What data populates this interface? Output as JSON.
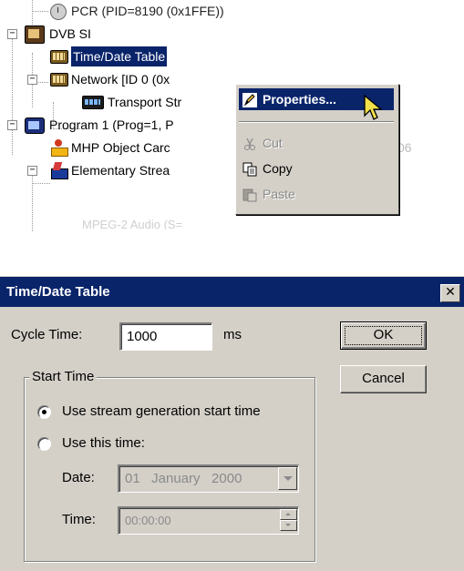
{
  "tree": {
    "items": [
      {
        "label": "PCR (PID=8190 (0x1FFE))",
        "icon": "clock-icon"
      },
      {
        "label": "DVB SI",
        "icon": "dvb-si-icon",
        "expander": "−"
      },
      {
        "label": "Time/Date Table",
        "icon": "table-icon",
        "selected": true
      },
      {
        "label": "Network [ID 0 (0x",
        "icon": "table-icon",
        "expander": "−"
      },
      {
        "label": "Transport Str",
        "icon": "film-icon"
      },
      {
        "label": "Program 1 (Prog=1, P",
        "icon": "program-icon",
        "expander": "−"
      },
      {
        "label": "MHP Object Carc",
        "icon": "mhp-icon"
      },
      {
        "label": "Elementary Strea",
        "icon": "elementary-stream-icon",
        "expander": "−"
      },
      {
        "label": "MPEG-2 Audio (S=",
        "icon": "audio-icon",
        "faded": true
      }
    ],
    "partial_right_text": "06"
  },
  "context_menu": {
    "items": [
      {
        "label": "Properties...",
        "icon": "pencil-icon",
        "state": "active"
      },
      {
        "label": "Cut",
        "icon": "scissors-icon",
        "state": "disabled"
      },
      {
        "label": "Copy",
        "icon": "copy-icon",
        "state": "enabled"
      },
      {
        "label": "Paste",
        "icon": "paste-icon",
        "state": "disabled"
      }
    ]
  },
  "dialog": {
    "title": "Time/Date Table",
    "close_symbol": "✕",
    "cycle_time_label": "Cycle Time:",
    "cycle_time_value": "1000",
    "cycle_time_unit": "ms",
    "ok_label": "OK",
    "cancel_label": "Cancel",
    "start_time_group": "Start Time",
    "radio_stream_label": "Use stream generation start time",
    "radio_stream_checked": true,
    "radio_this_time_label": "Use this time:",
    "date_label": "Date:",
    "date_value": "01   January   2000",
    "time_label": "Time:",
    "time_value": "00:00:00"
  },
  "colors": {
    "selection": "#0a246a",
    "window_face": "#d4d0c8",
    "title_bar": "#0a246a"
  }
}
